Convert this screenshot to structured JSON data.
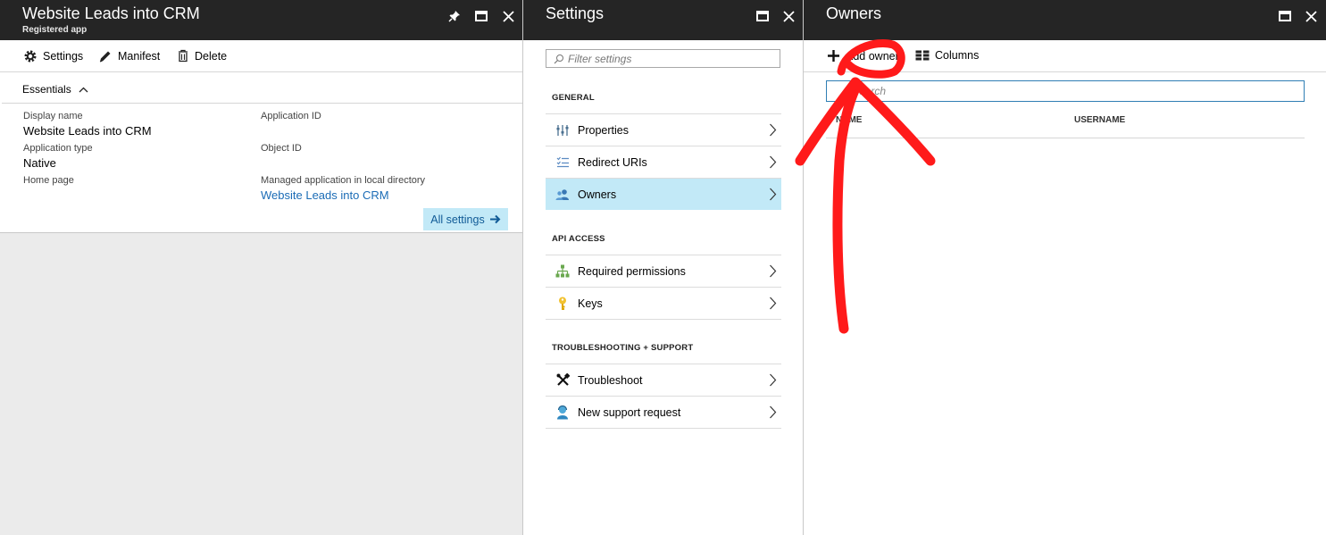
{
  "app_blade": {
    "title": "Website Leads into CRM",
    "subtitle": "Registered app",
    "commands": {
      "settings": "Settings",
      "manifest": "Manifest",
      "delete": "Delete"
    },
    "essentials": "Essentials",
    "props": {
      "display_name_label": "Display name",
      "display_name_value": "Website Leads into CRM",
      "app_type_label": "Application type",
      "app_type_value": "Native",
      "home_page_label": "Home page",
      "app_id_label": "Application ID",
      "object_id_label": "Object ID",
      "managed_app_label": "Managed application in local directory",
      "managed_app_value": "Website Leads into CRM"
    },
    "all_settings": "All settings"
  },
  "settings_blade": {
    "title": "Settings",
    "filter_placeholder": "Filter settings",
    "sections": [
      {
        "label": "GENERAL",
        "items": [
          "Properties",
          "Redirect URIs",
          "Owners"
        ]
      },
      {
        "label": "API ACCESS",
        "items": [
          "Required permissions",
          "Keys"
        ]
      },
      {
        "label": "TROUBLESHOOTING + SUPPORT",
        "items": [
          "Troubleshoot",
          "New support request"
        ]
      }
    ],
    "selected_item": "Owners"
  },
  "owners_blade": {
    "title": "Owners",
    "commands": {
      "add_owner": "Add owner",
      "columns": "Columns"
    },
    "search_placeholder": "Search",
    "columns": [
      "NAME",
      "USERNAME"
    ]
  },
  "colors": {
    "header_bg": "#252525",
    "selected_bg": "#c2e9f7",
    "link": "#1b6cb6",
    "annotation": "#ff0000"
  },
  "icons": [
    "settings-icon",
    "edit-icon",
    "trash-icon",
    "chevron-up-icon",
    "arrow-right-icon",
    "pin-icon",
    "maximize-icon",
    "close-icon",
    "search-icon",
    "properties-icon",
    "list-icon",
    "owners-icon",
    "permissions-icon",
    "key-icon",
    "tools-icon",
    "support-icon",
    "plus-icon",
    "columns-icon",
    "chevron-right-icon"
  ]
}
